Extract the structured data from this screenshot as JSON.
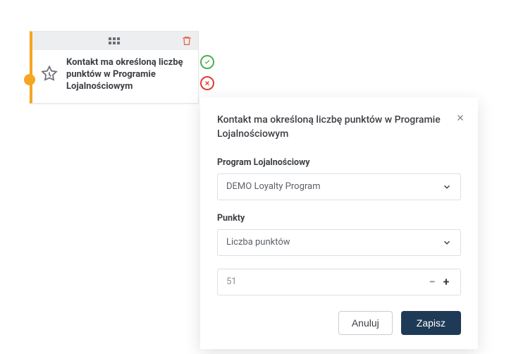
{
  "node": {
    "title": "Kontakt ma określoną liczbę punktów w Programie Lojalnościowym"
  },
  "modal": {
    "title": "Kontakt ma określoną liczbę punktów w Programie Lojalnościowym",
    "program_label": "Program Lojalnościowy",
    "program_value": "DEMO Loyalty Program",
    "points_label": "Punkty",
    "points_mode": "Liczba punktów",
    "points_value": "51",
    "cancel": "Anuluj",
    "save": "Zapisz"
  }
}
